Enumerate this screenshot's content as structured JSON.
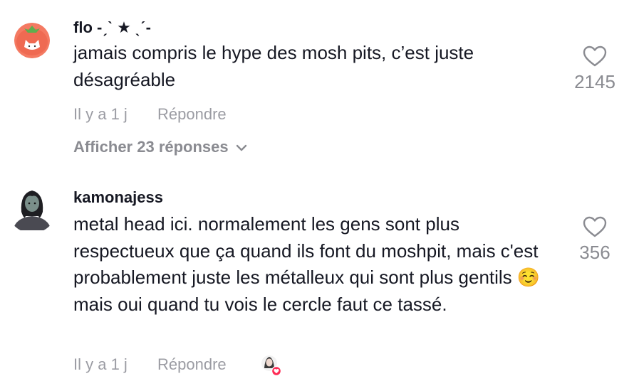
{
  "comments": [
    {
      "username": "flo -ˏˋ ★ ˎˊ-",
      "text": "jamais compris le hype des mosh pits, c’est juste désagréable",
      "time": "Il y a 1 j",
      "reply_label": "Répondre",
      "likes": "2145",
      "view_replies": "Afficher 23 réponses",
      "avatar_icon": "tomato-cat-avatar"
    },
    {
      "username": "kamonajess",
      "text": "metal head ici. normalement les gens sont plus respectueux que ça quand ils font du moshpit, mais c'est probablement juste les métalleux qui sont plus gentils ☺️mais oui quand tu vois le cercle faut ce tassé.",
      "time": "Il y a 1 j",
      "reply_label": "Répondre",
      "likes": "356",
      "avatar_icon": "girl-avatar",
      "liked_by_creator_icon": "creator-liked-heart-icon"
    }
  ],
  "colors": {
    "text": "#161823",
    "muted": "#9b9ca3",
    "heart_red": "#fe2c55",
    "tomato": "#f26b5b"
  }
}
